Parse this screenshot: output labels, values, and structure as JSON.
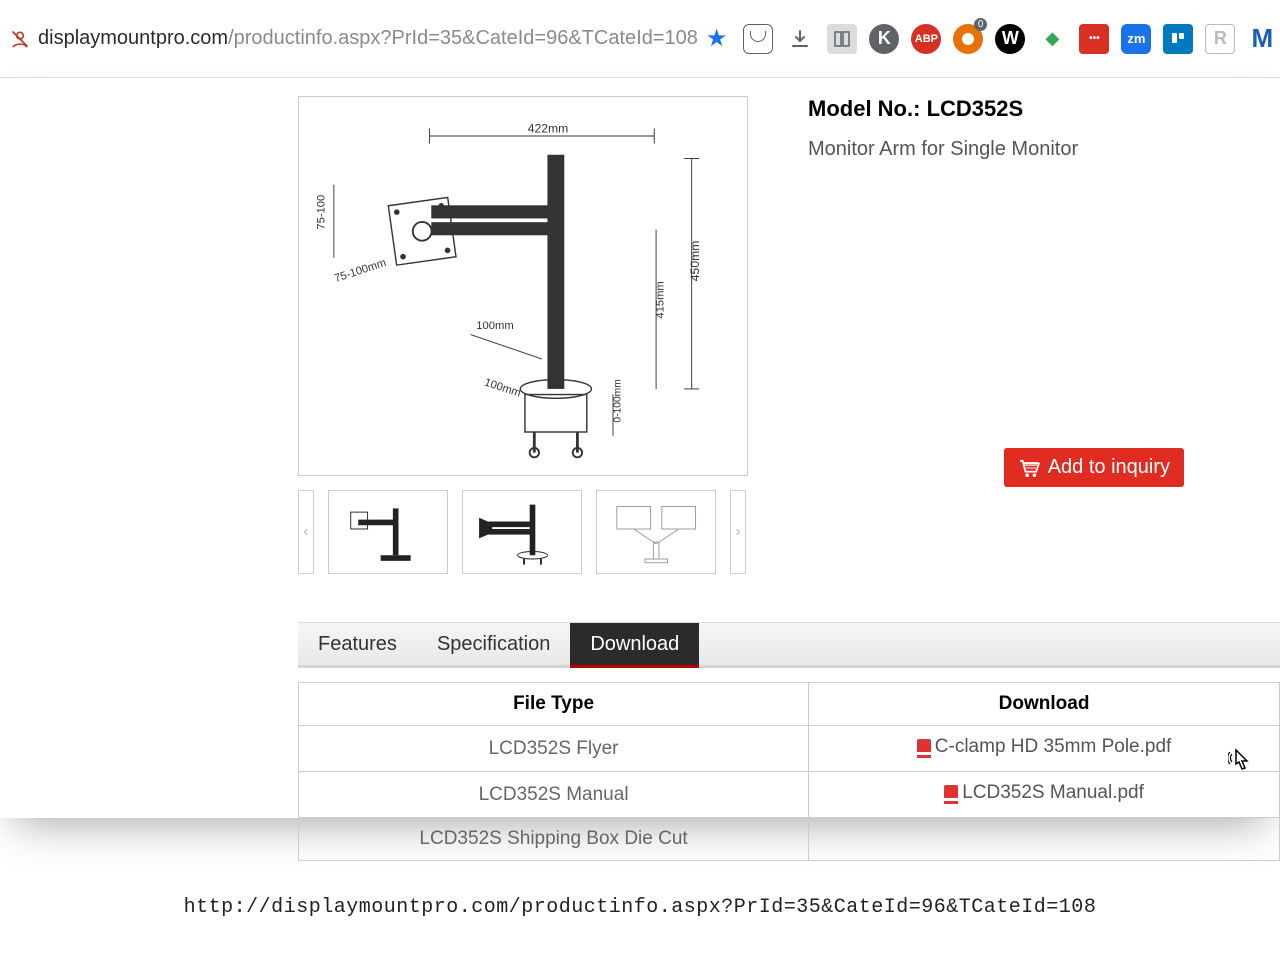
{
  "browser": {
    "url_dark": "displaymountpro.com",
    "url_gray": "/productinfo.aspx?PrId=35&CateId=96&TCateId=108",
    "toolbar_icons": [
      "pocket",
      "download",
      "reader",
      "K",
      "ABP",
      "ext",
      "W",
      "leaf",
      "•••",
      "zm",
      "trello",
      "R",
      "M"
    ]
  },
  "product": {
    "model_label": "Model No.:",
    "model_value": "LCD352S",
    "description": "Monitor Arm for Single Monitor",
    "add_to_inquiry": "Add to inquiry",
    "dimensions": {
      "top_width": "422mm",
      "vesa_h": "75-100mm",
      "vesa_v": "75-100",
      "pole_height": "450mm",
      "arm_offset": "100mm",
      "base_depth": "100mm",
      "working_height": "415mm",
      "clamp_height": "0-100mm"
    }
  },
  "tabs": {
    "features": "Features",
    "specification": "Specification",
    "download": "Download"
  },
  "download_table": {
    "col_filetype": "File Type",
    "col_download": "Download",
    "rows": [
      {
        "filetype": "LCD352S Flyer",
        "file": "C-clamp HD 35mm Pole.pdf"
      },
      {
        "filetype": "LCD352S Manual",
        "file": "LCD352S Manual.pdf"
      },
      {
        "filetype": "LCD352S Shipping Box Die Cut",
        "file": ""
      }
    ]
  },
  "footer_url": "http://displaymountpro.com/productinfo.aspx?PrId=35&CateId=96&TCateId=108"
}
